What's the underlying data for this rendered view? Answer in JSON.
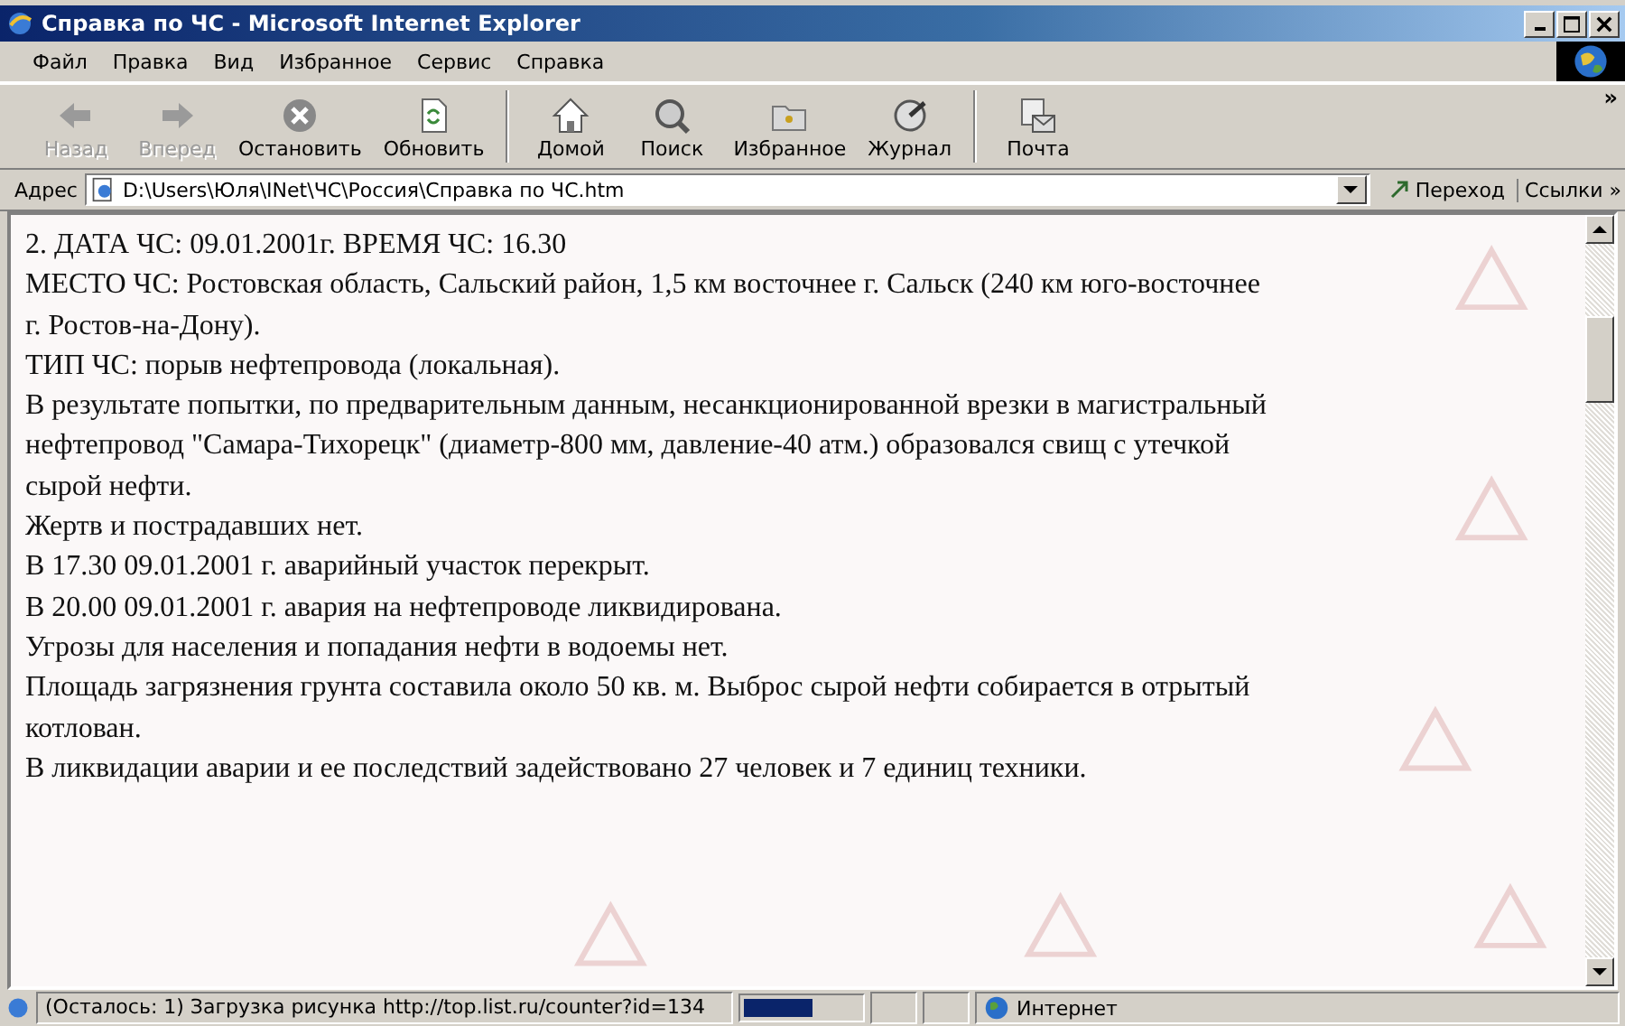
{
  "window": {
    "title": "Справка по ЧС - Microsoft Internet Explorer"
  },
  "menu": [
    "Файл",
    "Правка",
    "Вид",
    "Избранное",
    "Сервис",
    "Справка"
  ],
  "toolbar": [
    {
      "kind": "back",
      "label": "Назад",
      "disabled": true
    },
    {
      "kind": "forward",
      "label": "Вперед",
      "disabled": true
    },
    {
      "kind": "stop",
      "label": "Остановить",
      "disabled": false
    },
    {
      "kind": "refresh",
      "label": "Обновить",
      "disabled": false
    },
    {
      "kind": "home",
      "label": "Домой",
      "disabled": false
    },
    {
      "kind": "search",
      "label": "Поиск",
      "disabled": false
    },
    {
      "kind": "favorites",
      "label": "Избранное",
      "disabled": false
    },
    {
      "kind": "history",
      "label": "Журнал",
      "disabled": false
    },
    {
      "kind": "mail",
      "label": "Почта",
      "disabled": false
    }
  ],
  "toolbar_more": "»",
  "address": {
    "label": "Адрес",
    "value": "D:\\Users\\Юля\\INet\\ЧС\\Россия\\Справка по ЧС.htm",
    "go": "Переход",
    "links": "Ссылки",
    "links_more": "»"
  },
  "content": [
    "2. ДАТА ЧС: 09.01.2001г. ВРЕМЯ ЧС: 16.30",
    "МЕСТО ЧС: Ростовская область, Сальский район, 1,5 км восточнее г. Сальск (240 км юго-восточнее г. Ростов-на-Дону).",
    "ТИП ЧС: порыв нефтепровода (локальная).",
    "В результате попытки, по предварительным данным, несанкционированной врезки в магистральный нефтепровод \"Самара-Тихорецк\" (диаметр-800 мм, давление-40 атм.) образовался свищ с утечкой сырой нефти.",
    "Жертв и пострадавших нет.",
    "В 17.30 09.01.2001 г. аварийный участок перекрыт.",
    "В 20.00 09.01.2001 г. авария на нефтепроводе ликвидирована.",
    "Угрозы для населения и попадания нефти в водоемы нет.",
    "Площадь загрязнения грунта составила около 50 кв. м. Выброс сырой нефти собирается в отрытый котлован.",
    "В ликвидации аварии и ее последствий задействовано 27 человек и 7 единиц техники."
  ],
  "status": {
    "text": "(Осталось: 1) Загрузка рисунка http://top.list.ru/counter?id=134",
    "progress": {
      "level": 0.6
    },
    "zone": "Интернет"
  }
}
